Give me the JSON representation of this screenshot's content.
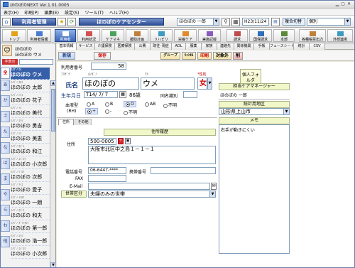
{
  "window": {
    "title": "ほのぼのNEXT  Ver.1.01.0005"
  },
  "menu": [
    "表示(H)",
    "印刷(P)",
    "編集(E)",
    "設定(S)",
    "ツール(T)",
    "ヘルプ(H)"
  ],
  "toolbar": {
    "section_title": "利用者管理",
    "center_title": "ほのぼのケアセンター",
    "user_name": "ほのぼの 一郎",
    "date": "H23/11/24",
    "mode_select": "複合切替",
    "mode_value": "個別"
  },
  "nav_buttons": [
    {
      "label": "トップ"
    },
    {
      "label": "利用者情報"
    },
    {
      "label": "利用者"
    },
    {
      "label": "利用状況"
    },
    {
      "label": "ケアマネ"
    },
    {
      "label": "援助計画"
    },
    {
      "label": "リハビリ"
    },
    {
      "label": "栄養ケア"
    },
    {
      "label": "実施記録"
    },
    {
      "label": "請求"
    },
    {
      "label": "国保請求"
    },
    {
      "label": "本部"
    },
    {
      "label": "各種帳票出力"
    },
    {
      "label": "外部連携"
    }
  ],
  "left_panel": {
    "company": "ほのぼの",
    "selected_name": "ほのぼの ウメ",
    "badge": "字表示",
    "kana_tabs": [
      "全",
      "あ",
      "か",
      "さ",
      "た",
      "な",
      "は",
      "ま",
      "や",
      "ら",
      "わ",
      "他"
    ],
    "residents": [
      {
        "kana": "ﾎﾉﾎﾞﾉ ｳﾒ",
        "name": "ほのぼの ウメ"
      },
      {
        "kana": "ﾎﾉﾎﾞﾉ ﾀﾛｳ",
        "name": "ほのぼの 太郎"
      },
      {
        "kana": "ﾎﾉﾎﾞﾉ ﾊﾅｺ",
        "name": "ほのぼの 花子"
      },
      {
        "kana": "ﾎﾉﾎﾞﾉ ﾐﾖ",
        "name": "ほのぼの 美代"
      },
      {
        "kana": "ﾎﾉﾎﾞﾉ ﾕｳｼﾞ",
        "name": "ほのぼの 勇吉"
      },
      {
        "kana": "ﾎﾉﾎﾞﾉ ﾐｴ",
        "name": "ほのぼの 美恵"
      },
      {
        "kana": "ﾎﾉﾎﾞﾉ ｶｽﾞｴ",
        "name": "ほのぼの 和江"
      },
      {
        "kana": "ﾎﾉﾎﾞﾉ ｺｼﾞﾛｳ",
        "name": "ほのぼの 小次郎"
      },
      {
        "kana": "ﾎﾉﾎﾞﾉ ｼﾞﾛｳ",
        "name": "ほのぼの 次郎"
      },
      {
        "kana": "ﾎﾉﾎﾞﾉ ｱｲｺ",
        "name": "ほのぼの 愛子"
      },
      {
        "kana": "ﾎﾉﾎﾞﾉ ｲﾁﾛｳ",
        "name": "ほのぼの 一朗"
      },
      {
        "kana": "ﾎﾉﾎﾞﾉ ｶｽﾞｵ",
        "name": "ほのぼの 和夫"
      },
      {
        "kana": "ﾎﾉﾎﾞﾉ ﾀﾞｲｲﾁﾛｳ",
        "name": "ほのぼの 第一郎"
      },
      {
        "kana": "ﾎﾉﾎﾞﾉ ｺｳｼﾞ",
        "name": "ほのぼの 浩一郎"
      },
      {
        "kana": "ﾎﾉﾎﾞﾉ ｺｼﾞﾛｳ",
        "name": "ほのぼの 小次郎"
      }
    ]
  },
  "sub_tabs": [
    "基本情報",
    "サービス",
    "介護保険",
    "医療保険",
    "公費",
    "既往･現症",
    "ADL",
    "服薬",
    "家族",
    "連絡先",
    "関係機関",
    "手帳",
    "フェースシート",
    "統計",
    "CSV"
  ],
  "actions": {
    "new": "新規",
    "save": "保存",
    "group": "グループ",
    "cancel": "ｷｬﾝｾﾙ",
    "print": "印刷",
    "target": "対象外",
    "del": "削"
  },
  "form": {
    "user_number_label": "利用者番号",
    "user_number": "58",
    "kana_label": "ﾌﾘｶﾞﾅ",
    "kana_sei": "ﾎﾉﾎﾞﾉ",
    "kana_mei": "ｳﾒ",
    "gender_label": "*性別",
    "name_label": "氏名",
    "sei": "ほのぼの",
    "mei": "ウメ",
    "gender": "女",
    "birth_label": "生年月日",
    "birth": "T14/ 7/ 7",
    "age": "86歳",
    "same_name_label": "同名識別",
    "blood_label": "血液型",
    "rh_label": "(RH)",
    "blood_options": [
      "A",
      "B",
      "O",
      "AB",
      "不明"
    ],
    "rh_options": [
      "+",
      "-",
      "不明"
    ],
    "individual_folder": "個人フォルダ",
    "caremanager_label": "担当ケアマネージャー",
    "caremanager": "ほのぼの 一郎",
    "region_label": "統計用地区",
    "region": "山形県上山市",
    "memo_label": "メモ",
    "memo": "右手が動きにくい"
  },
  "address": {
    "tab_current": "住所",
    "tab_other": "その他",
    "history_label": "住所履歴",
    "address_label": "住所",
    "zip": "500-0005",
    "address_line": "大阪市北区中之島１－１－１",
    "phone_label": "電話番号",
    "phone": "06-6447-****",
    "mobile_label": "携帯番号",
    "fax_label": "FAX",
    "email_label": "E-Mail",
    "household_label": "世帯区分",
    "household": "夫婦のみの世帯"
  }
}
